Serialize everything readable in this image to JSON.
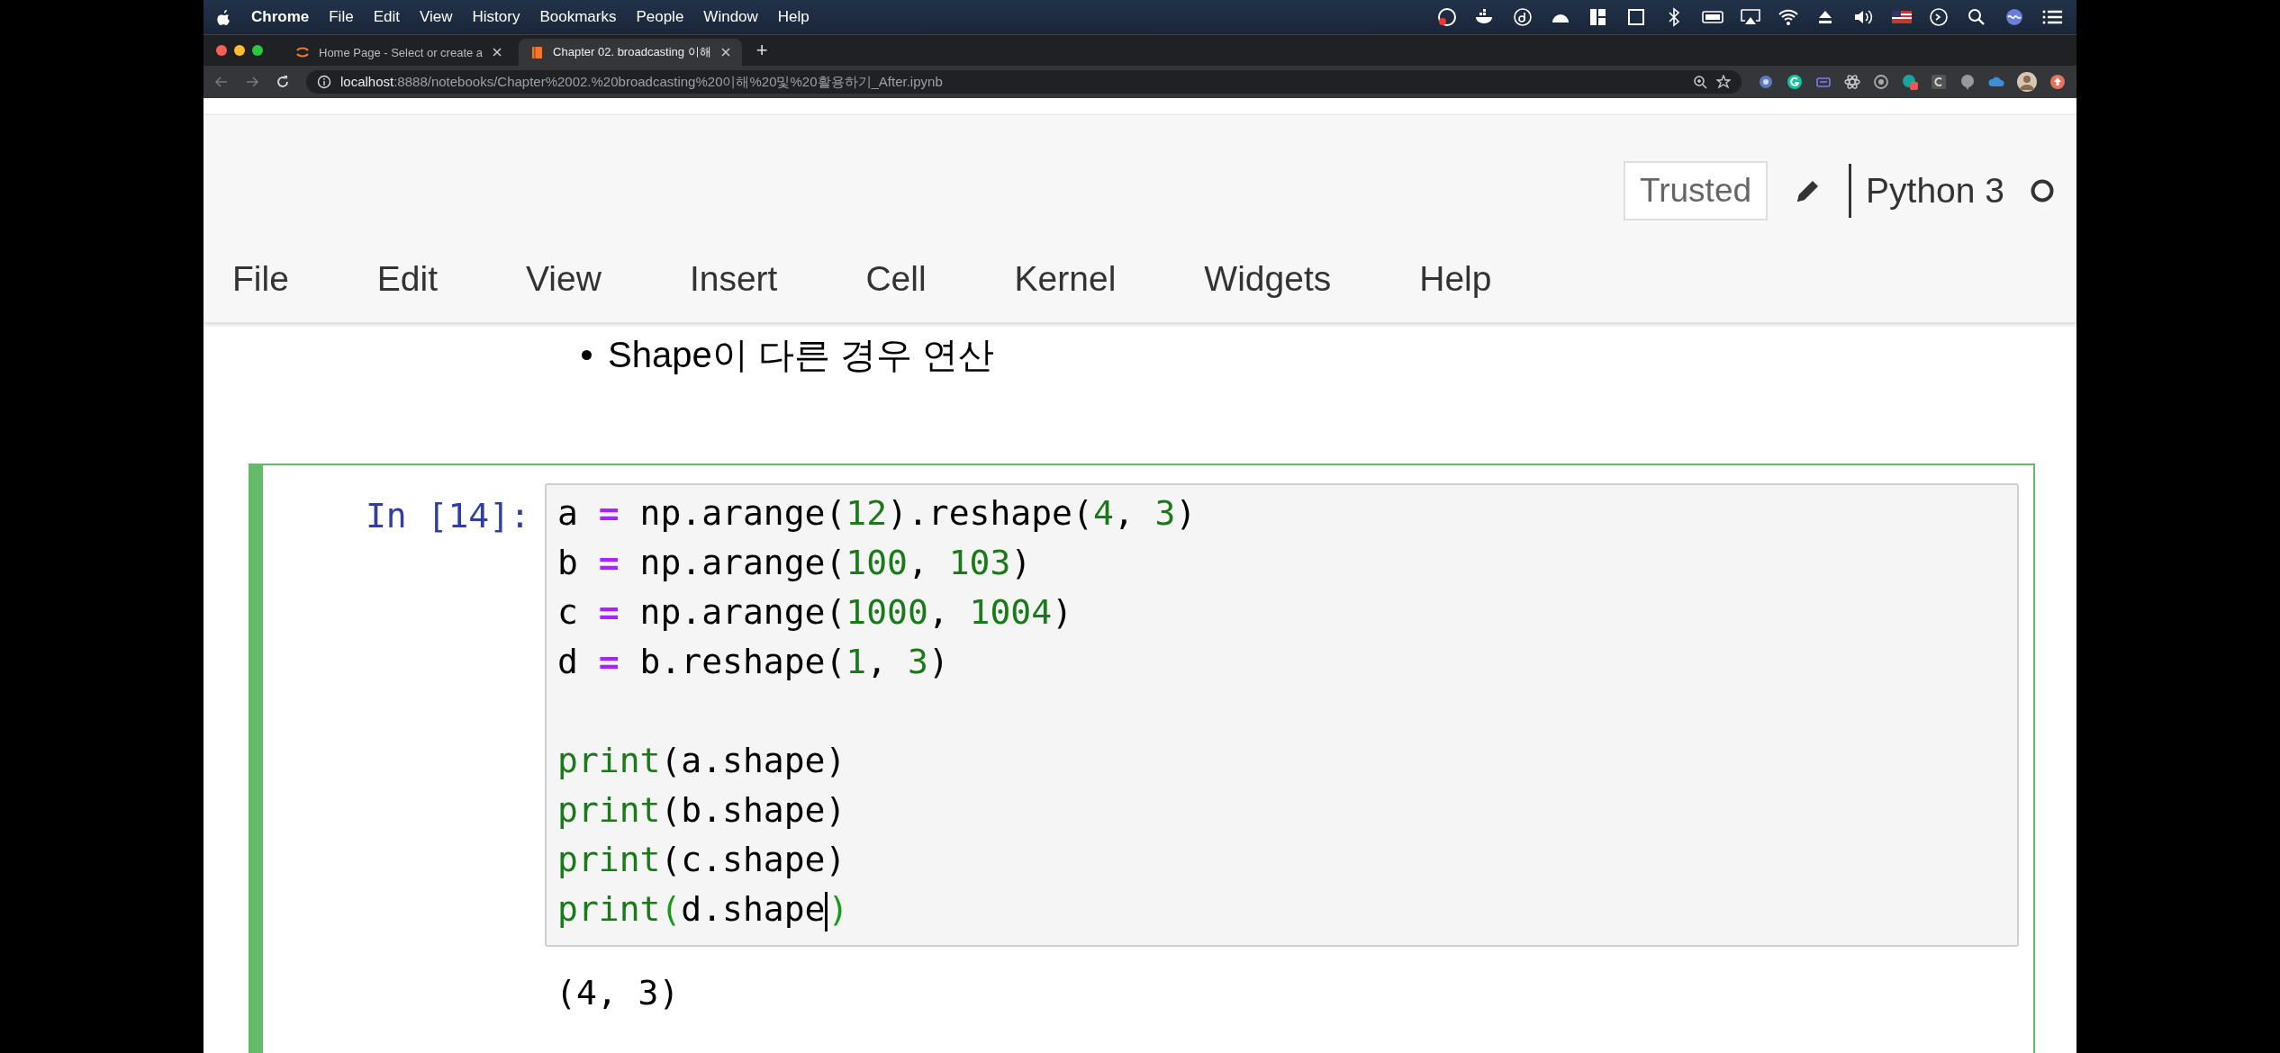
{
  "menubar": {
    "app": "Chrome",
    "items": [
      "File",
      "Edit",
      "View",
      "History",
      "Bookmarks",
      "People",
      "Window",
      "Help"
    ]
  },
  "browser": {
    "tabs": [
      {
        "title": "Home Page - Select or create a",
        "selected": false
      },
      {
        "title": "Chapter 02. broadcasting 이해",
        "selected": true
      }
    ],
    "new_tab": "+",
    "address": {
      "host": "localhost",
      "path": ":8888/notebooks/Chapter%2002.%20broadcasting%20이해%20및%20활용하기_After.ipynb"
    }
  },
  "notebook": {
    "trusted": "Trusted",
    "kernel": "Python 3",
    "kernel_busy": false,
    "menu": [
      "File",
      "Edit",
      "View",
      "Insert",
      "Cell",
      "Kernel",
      "Widgets",
      "Help"
    ]
  },
  "markdown": {
    "bullets": [
      "Shape이 다른 경우 연산"
    ]
  },
  "cell": {
    "selected": true,
    "prompt": "In [14]:",
    "lines": [
      {
        "kind": "code",
        "tokens": [
          {
            "kind": "plain",
            "text": "a "
          },
          {
            "kind": "op",
            "text": "="
          },
          {
            "kind": "plain",
            "text": " np.arange("
          },
          {
            "kind": "num",
            "text": "12"
          },
          {
            "kind": "plain",
            "text": ").reshape("
          },
          {
            "kind": "num",
            "text": "4"
          },
          {
            "kind": "plain",
            "text": ", "
          },
          {
            "kind": "num",
            "text": "3"
          },
          {
            "kind": "plain",
            "text": ")"
          }
        ]
      },
      {
        "kind": "code",
        "tokens": [
          {
            "kind": "plain",
            "text": "b "
          },
          {
            "kind": "op",
            "text": "="
          },
          {
            "kind": "plain",
            "text": " np.arange("
          },
          {
            "kind": "num",
            "text": "100"
          },
          {
            "kind": "plain",
            "text": ", "
          },
          {
            "kind": "num",
            "text": "103"
          },
          {
            "kind": "plain",
            "text": ")"
          }
        ]
      },
      {
        "kind": "code",
        "tokens": [
          {
            "kind": "plain",
            "text": "c "
          },
          {
            "kind": "op",
            "text": "="
          },
          {
            "kind": "plain",
            "text": " np.arange("
          },
          {
            "kind": "num",
            "text": "1000"
          },
          {
            "kind": "plain",
            "text": ", "
          },
          {
            "kind": "num",
            "text": "1004"
          },
          {
            "kind": "plain",
            "text": ")"
          }
        ]
      },
      {
        "kind": "code",
        "tokens": [
          {
            "kind": "plain",
            "text": "d "
          },
          {
            "kind": "op",
            "text": "="
          },
          {
            "kind": "plain",
            "text": " b.reshape("
          },
          {
            "kind": "num",
            "text": "1"
          },
          {
            "kind": "plain",
            "text": ", "
          },
          {
            "kind": "num",
            "text": "3"
          },
          {
            "kind": "plain",
            "text": ")"
          }
        ]
      },
      {
        "kind": "blank"
      },
      {
        "kind": "code",
        "tokens": [
          {
            "kind": "builtin",
            "text": "print"
          },
          {
            "kind": "plain",
            "text": "(a.shape)"
          }
        ]
      },
      {
        "kind": "code",
        "tokens": [
          {
            "kind": "builtin",
            "text": "print"
          },
          {
            "kind": "plain",
            "text": "(b.shape)"
          }
        ]
      },
      {
        "kind": "code",
        "tokens": [
          {
            "kind": "builtin",
            "text": "print"
          },
          {
            "kind": "plain",
            "text": "(c.shape)"
          }
        ]
      },
      {
        "kind": "code",
        "tokens": [
          {
            "kind": "builtin",
            "text": "print"
          },
          {
            "kind": "match",
            "text": "("
          },
          {
            "kind": "plain",
            "text": "d.shape"
          },
          {
            "kind": "cursor"
          },
          {
            "kind": "match",
            "text": ")"
          }
        ]
      }
    ],
    "output": [
      "(4, 3)"
    ]
  }
}
